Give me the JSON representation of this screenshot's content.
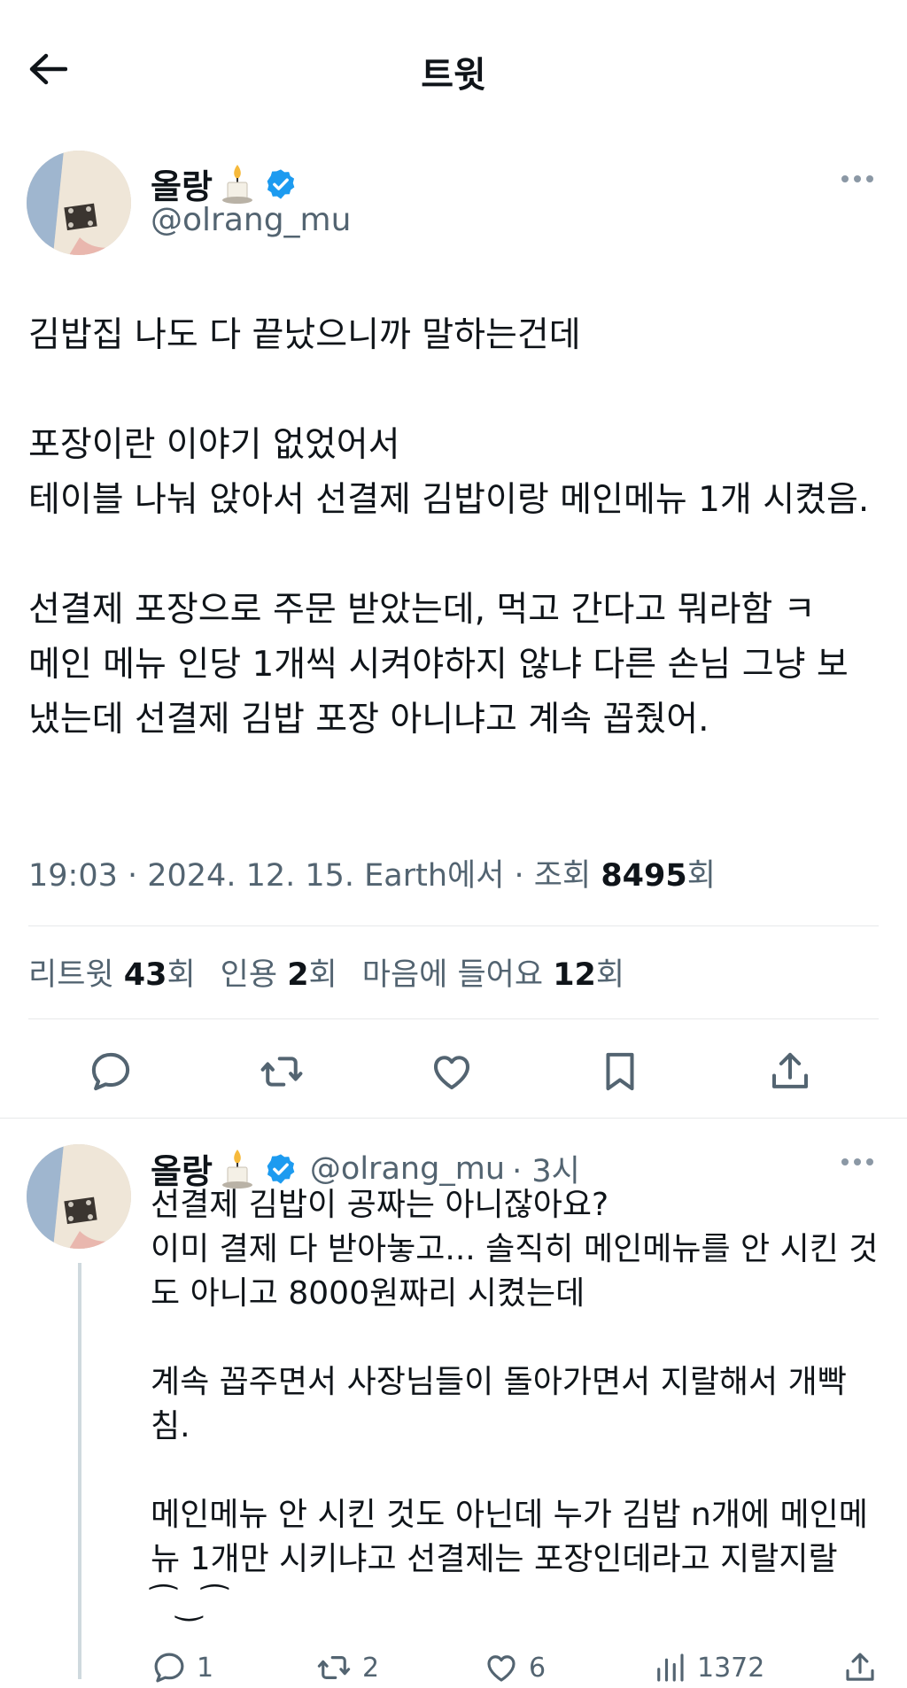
{
  "header": {
    "title": "트윗"
  },
  "tweet": {
    "author_name": "올랑",
    "author_handle": "@olrang_mu",
    "body": "김밥집 나도 다 끝났으니까 말하는건데\n\n포장이란 이야기 없었어서\n테이블 나눠 앉아서 선결제 김밥이랑 메인메뉴 1개 시켰음.\n\n선결제 포장으로 주문 받았는데, 먹고 간다고 뭐라함 ㅋ\n메인 메뉴 인당 1개씩 시켜야하지 않냐 다른 손님 그냥 보냈는데 선결제 김밥 포장 아니냐고 계속 꼽줬어.",
    "meta_prefix": "19:03 · 2024. 12. 15. Earth에서 · 조회 ",
    "views": "8495",
    "views_suffix": "회"
  },
  "stats": {
    "retweets_label": "리트윗 ",
    "retweets": "43",
    "retweets_suffix": "회",
    "quotes_label": "인용 ",
    "quotes": "2",
    "quotes_suffix": "회",
    "likes_label": "마음에 들어요 ",
    "likes": "12",
    "likes_suffix": "회"
  },
  "reply": {
    "author_name": "올랑",
    "author_handle": "@olrang_mu",
    "time": "· 3시",
    "body": "선결제 김밥이 공짜는 아니잖아요?\n이미 결제 다 받아놓고... 솔직히 메인메뉴를 안 시킨 것도 아니고 8000원짜리 시켰는데\n\n계속 꼽주면서 사장님들이 돌아가면서 지랄해서 개빡침.\n\n메인메뉴 안 시킨 것도 아닌데 누가 김밥 n개에 메인메뉴 1개만 시키냐고 선결제는 포장인데라고 지랄지랄\n⁀‿⁀",
    "reply_count": "1",
    "retweet_count": "2",
    "like_count": "6",
    "view_count": "1372"
  },
  "colors": {
    "accent": "#1d9bf0",
    "text": "#0f1419",
    "muted": "#536471",
    "divider": "#e7e9ea"
  },
  "icons": [
    "back-arrow-icon",
    "candle-icon",
    "verified-badge-icon",
    "more-icon",
    "reply-icon",
    "retweet-icon",
    "like-icon",
    "bookmark-icon",
    "share-icon",
    "views-icon"
  ]
}
